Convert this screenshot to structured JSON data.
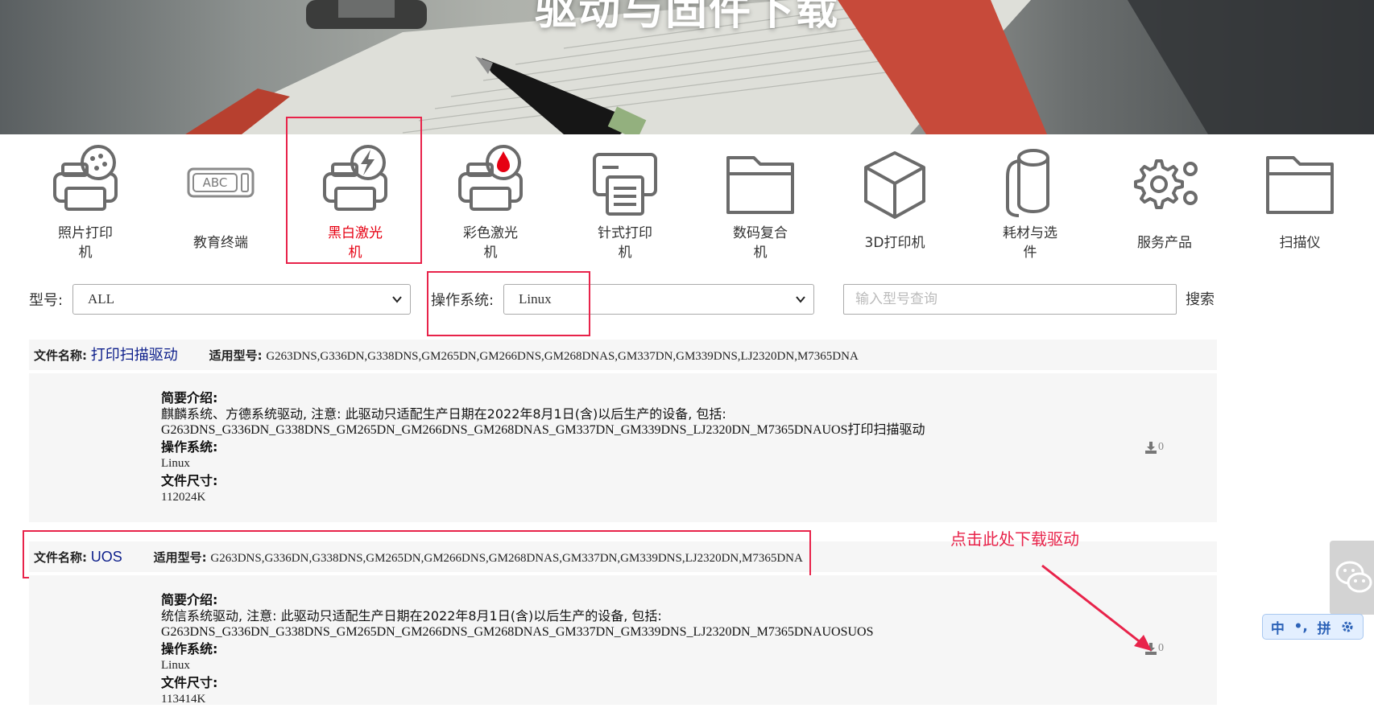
{
  "hero": {
    "title": "驱动与固件下载"
  },
  "categories": [
    {
      "label": "照片打印机",
      "icon": "photo-printer-icon"
    },
    {
      "label": "教育终端",
      "icon": "education-terminal-icon"
    },
    {
      "label": "黑白激光机",
      "icon": "mono-laser-icon",
      "active": true
    },
    {
      "label": "彩色激光机",
      "icon": "color-laser-icon"
    },
    {
      "label": "针式打印机",
      "icon": "dot-matrix-printer-icon"
    },
    {
      "label": "数码复合机",
      "icon": "digital-mfp-icon"
    },
    {
      "label": "3D打印机",
      "icon": "3d-printer-icon"
    },
    {
      "label": "耗材与选件",
      "icon": "consumables-icon"
    },
    {
      "label": "服务产品",
      "icon": "gears-icon"
    },
    {
      "label": "扫描仪",
      "icon": "scanner-icon"
    }
  ],
  "filters": {
    "model_label": "型号:",
    "model_value": "ALL",
    "os_label": "操作系统:",
    "os_value": "Linux",
    "search_placeholder": "输入型号查询",
    "search_button": "搜索"
  },
  "labels": {
    "file_name": "文件名称:",
    "models": "适用型号:",
    "intro": "简要介绍:",
    "os": "操作系统:",
    "size": "文件尺寸:"
  },
  "files": [
    {
      "name": "打印扫描驱动",
      "models": "G263DNS,G336DN,G338DNS,GM265DN,GM266DNS,GM268DNAS,GM337DN,GM339DNS,LJ2320DN,M7365DNA",
      "intro_line1": "麒麟系统、方德系统驱动, 注意: 此驱动只适配生产日期在2022年8月1日(含)以后生产的设备, 包括:",
      "intro_line2": "G263DNS_G336DN_G338DNS_GM265DN_GM266DNS_GM268DNAS_GM337DN_GM339DNS_LJ2320DN_M7365DNAUOS打印扫描驱动",
      "os": "Linux",
      "size": "112024K",
      "downloads": "0"
    },
    {
      "name": "UOS",
      "models": "G263DNS,G336DN,G338DNS,GM265DN,GM266DNS,GM268DNAS,GM337DN,GM339DNS,LJ2320DN,M7365DNA",
      "intro_line1": "统信系统驱动, 注意: 此驱动只适配生产日期在2022年8月1日(含)以后生产的设备, 包括:",
      "intro_line2": "G263DNS_G336DN_G338DNS_GM265DN_GM266DNS_GM268DNAS_GM337DN_GM339DNS_LJ2320DN_M7365DNAUOSUOS",
      "os": "Linux",
      "size": "113414K",
      "downloads": "0"
    }
  ],
  "annotation": {
    "note": "点击此处下载驱动"
  },
  "ime": {
    "lang": "中",
    "punct": "•,",
    "mode": "拼",
    "settings_icon": "gear-icon"
  },
  "colors": {
    "active": "#e60012",
    "highlight": "#e8234a",
    "file_name": "#0b1d8a"
  }
}
